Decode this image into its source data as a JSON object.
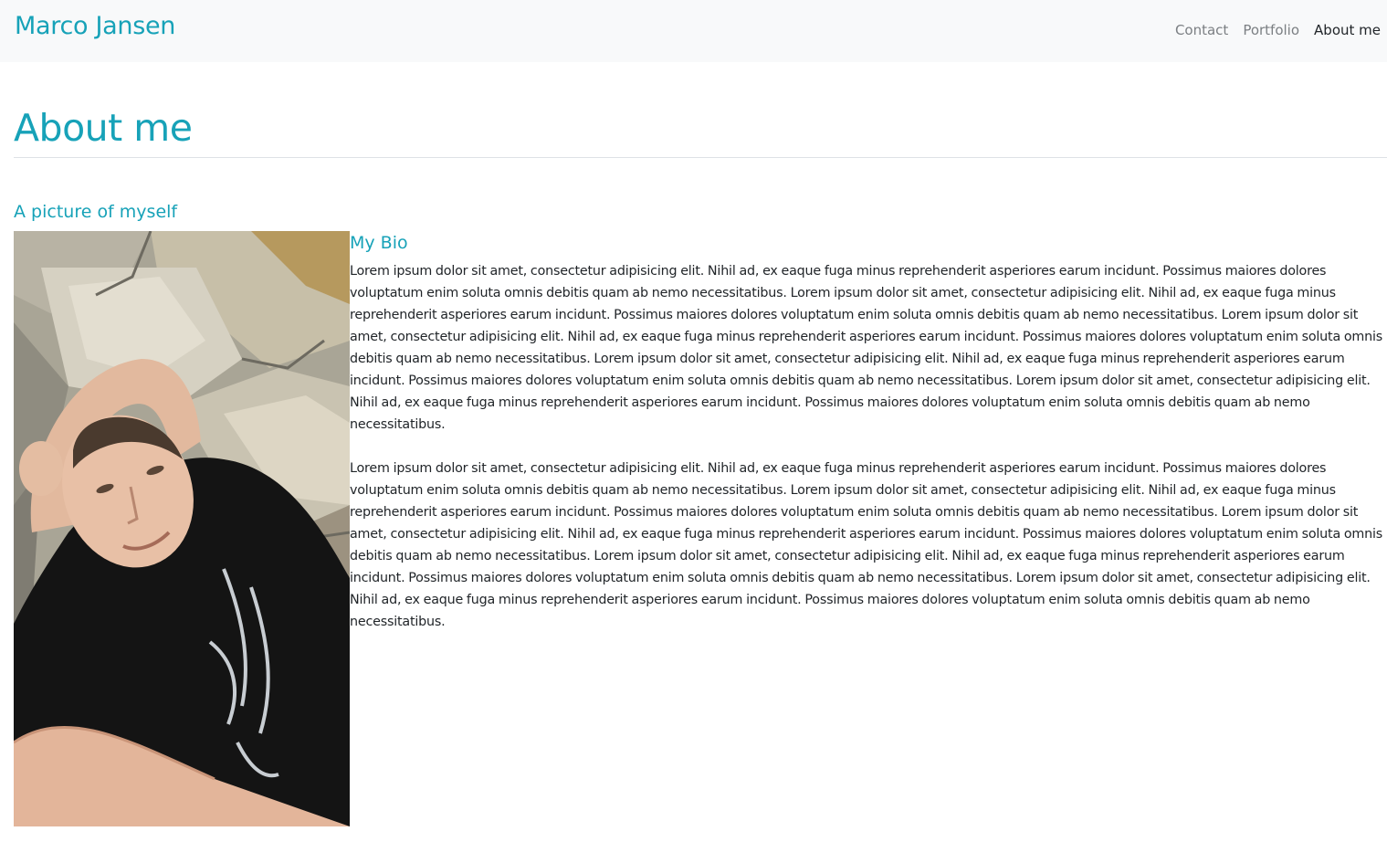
{
  "header": {
    "brand": "Marco Jansen",
    "nav": [
      {
        "label": "Contact"
      },
      {
        "label": "Portfolio"
      },
      {
        "label": "About me"
      }
    ]
  },
  "main": {
    "title": "About me",
    "picture_heading": "A picture of myself",
    "bio_heading": "My Bio",
    "bio_paragraphs": [
      "Lorem ipsum dolor sit amet, consectetur adipisicing elit. Nihil ad, ex eaque fuga minus reprehenderit asperiores earum incidunt. Possimus maiores dolores voluptatum enim soluta omnis debitis quam ab nemo necessitatibus. Lorem ipsum dolor sit amet, consectetur adipisicing elit. Nihil ad, ex eaque fuga minus reprehenderit asperiores earum incidunt. Possimus maiores dolores voluptatum enim soluta omnis debitis quam ab nemo necessitatibus. Lorem ipsum dolor sit amet, consectetur adipisicing elit. Nihil ad, ex eaque fuga minus reprehenderit asperiores earum incidunt. Possimus maiores dolores voluptatum enim soluta omnis debitis quam ab nemo necessitatibus. Lorem ipsum dolor sit amet, consectetur adipisicing elit. Nihil ad, ex eaque fuga minus reprehenderit asperiores earum incidunt. Possimus maiores dolores voluptatum enim soluta omnis debitis quam ab nemo necessitatibus. Lorem ipsum dolor sit amet, consectetur adipisicing elit. Nihil ad, ex eaque fuga minus reprehenderit asperiores earum incidunt. Possimus maiores dolores voluptatum enim soluta omnis debitis quam ab nemo necessitatibus.",
      "Lorem ipsum dolor sit amet, consectetur adipisicing elit. Nihil ad, ex eaque fuga minus reprehenderit asperiores earum incidunt. Possimus maiores dolores voluptatum enim soluta omnis debitis quam ab nemo necessitatibus. Lorem ipsum dolor sit amet, consectetur adipisicing elit. Nihil ad, ex eaque fuga minus reprehenderit asperiores earum incidunt. Possimus maiores dolores voluptatum enim soluta omnis debitis quam ab nemo necessitatibus. Lorem ipsum dolor sit amet, consectetur adipisicing elit. Nihil ad, ex eaque fuga minus reprehenderit asperiores earum incidunt. Possimus maiores dolores voluptatum enim soluta omnis debitis quam ab nemo necessitatibus. Lorem ipsum dolor sit amet, consectetur adipisicing elit. Nihil ad, ex eaque fuga minus reprehenderit asperiores earum incidunt. Possimus maiores dolores voluptatum enim soluta omnis debitis quam ab nemo necessitatibus. Lorem ipsum dolor sit amet, consectetur adipisicing elit. Nihil ad, ex eaque fuga minus reprehenderit asperiores earum incidunt. Possimus maiores dolores voluptatum enim soluta omnis debitis quam ab nemo necessitatibus."
    ]
  },
  "colors": {
    "accent": "#17a2b8",
    "navbar_bg": "#f8f9fa",
    "nav_inactive": "#7b7f83",
    "text": "#212529"
  }
}
